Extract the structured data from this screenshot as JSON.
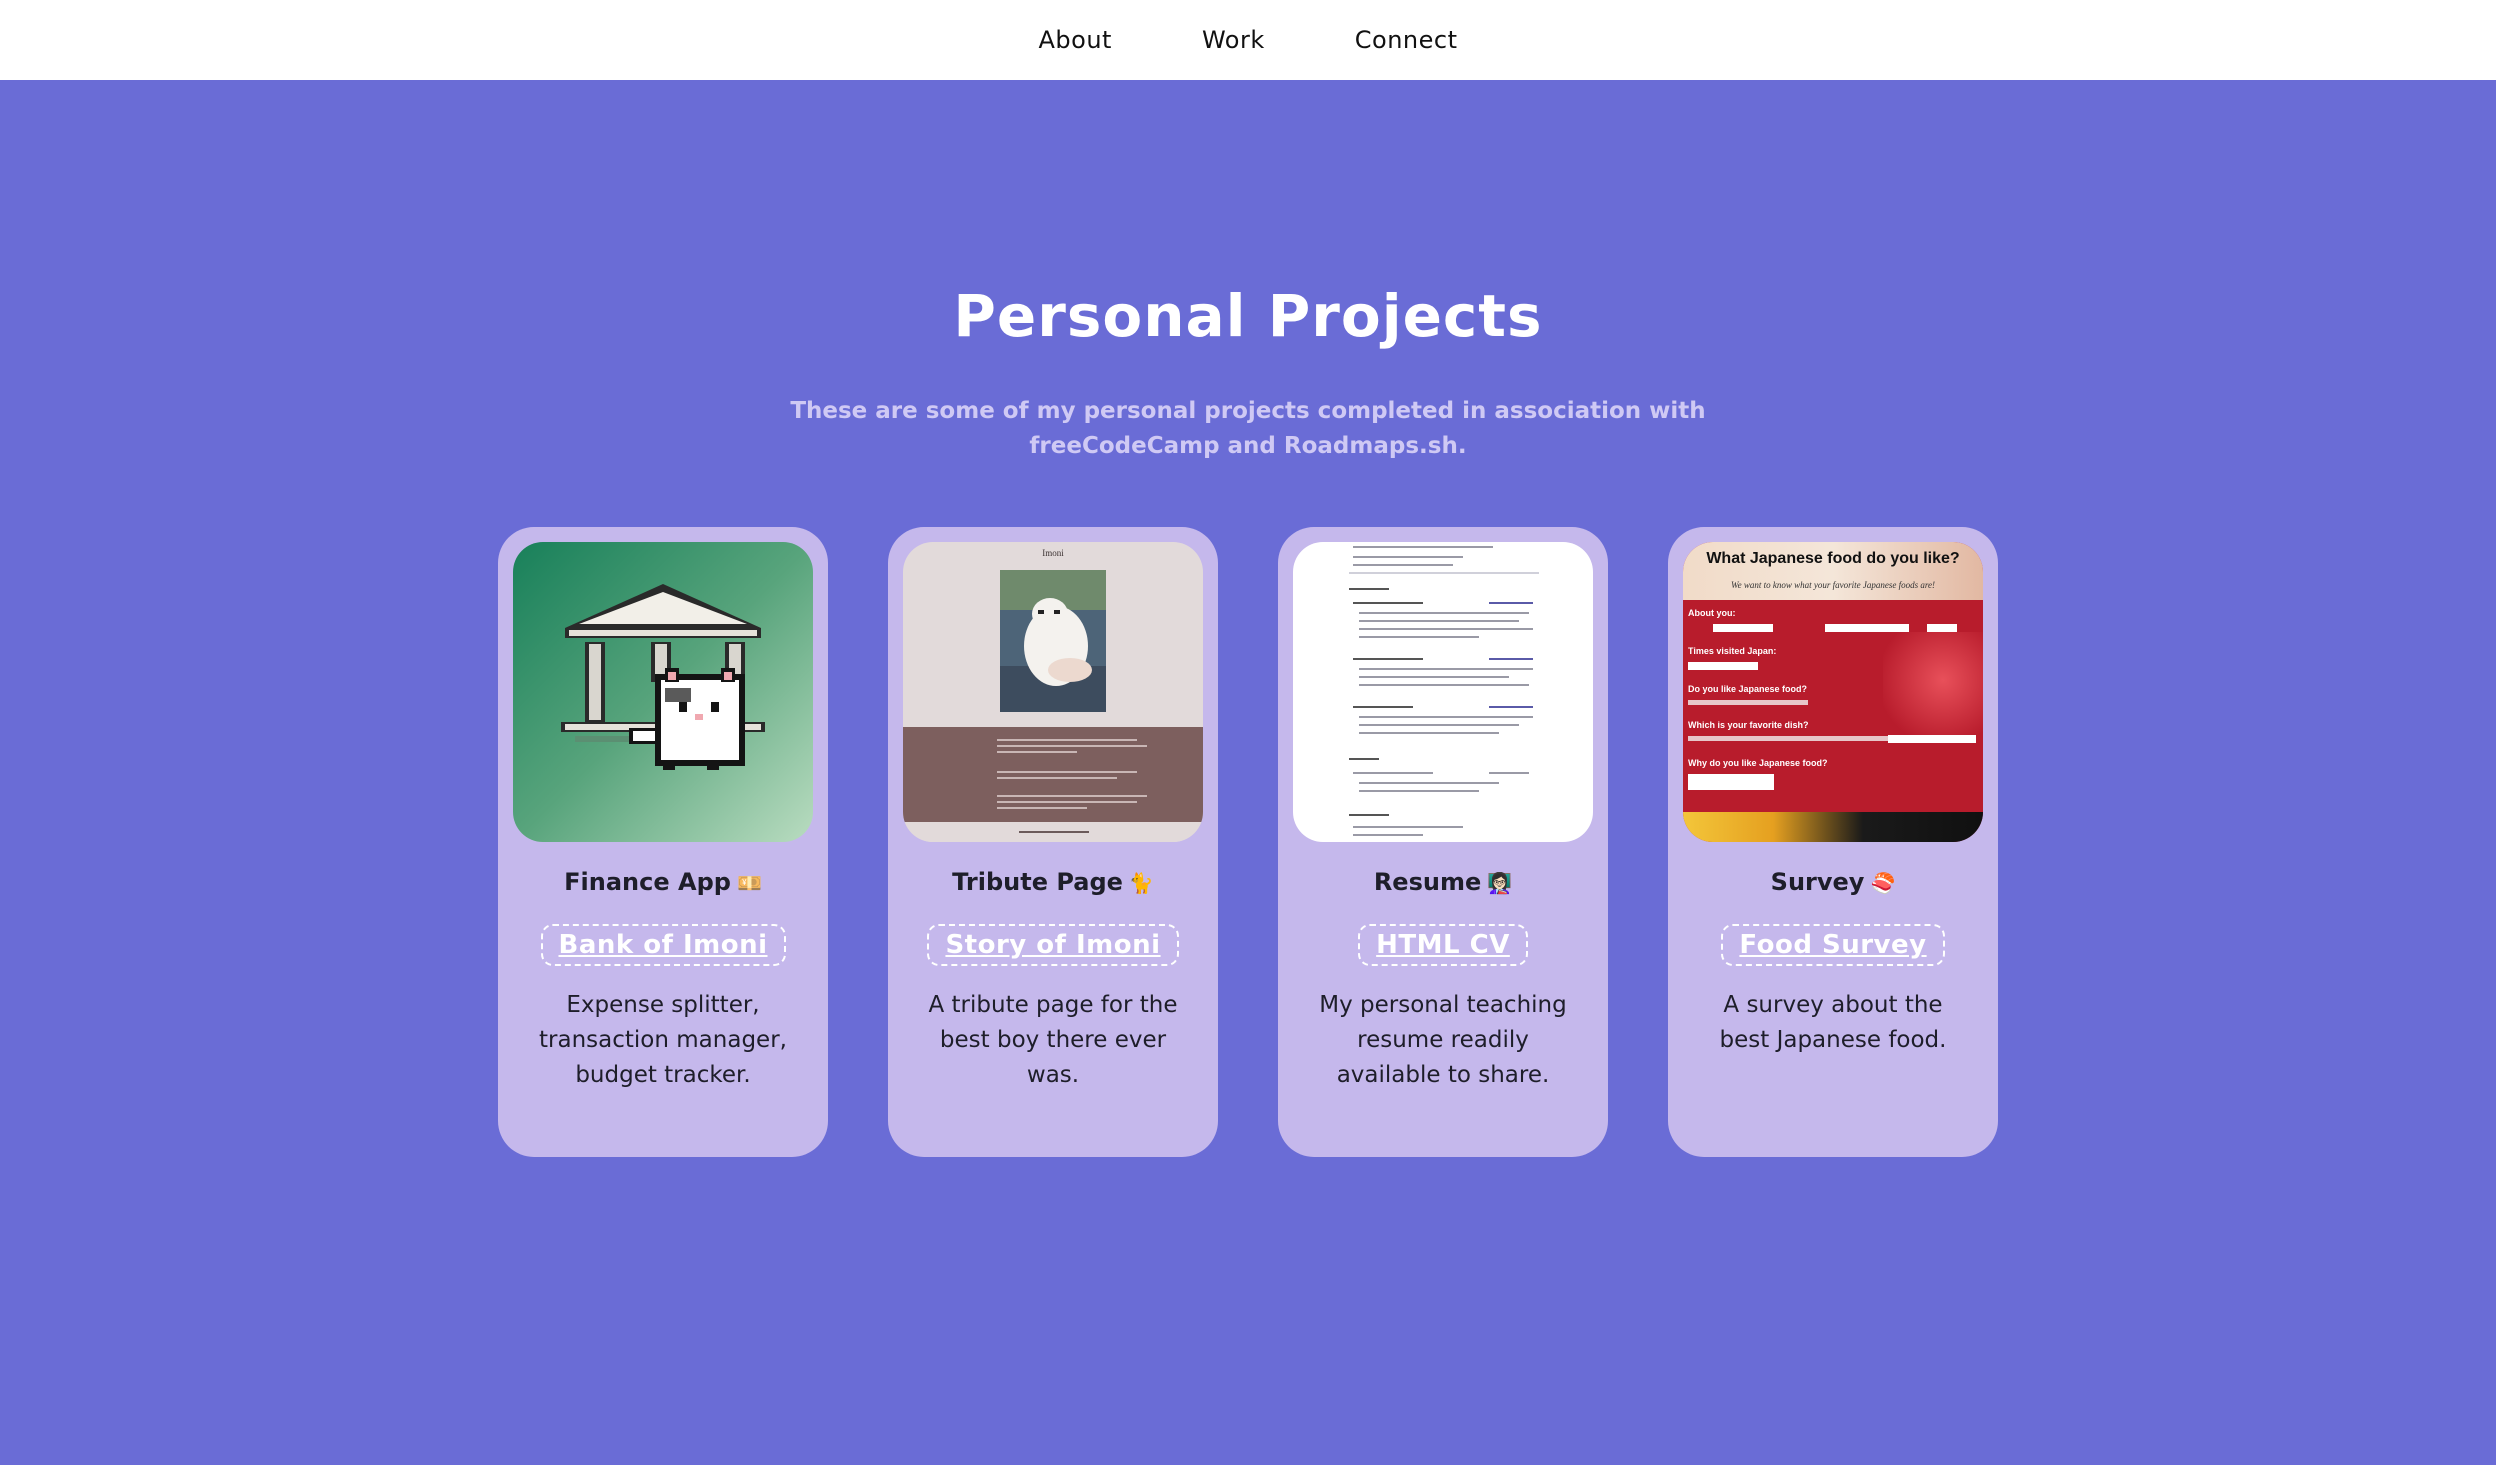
{
  "nav": {
    "items": [
      {
        "label": "About"
      },
      {
        "label": "Work"
      },
      {
        "label": "Connect"
      }
    ]
  },
  "section": {
    "title": "Personal Projects",
    "subtitle": "These are some of my personal projects completed in association with freeCodeCamp and Roadmaps.sh."
  },
  "projects": [
    {
      "name": "Finance App",
      "emoji": "💴",
      "link_label": "Bank of Imoni",
      "description": "Expense splitter, transaction manager, budget tracker.",
      "thumbnail": "pixel-bank-cat-icon"
    },
    {
      "name": "Tribute Page",
      "emoji": "🐈",
      "link_label": "Story of Imoni",
      "description": "A tribute page for the best boy there ever was.",
      "thumbnail": "tribute-page-screenshot",
      "thumb_heading": "Imoni"
    },
    {
      "name": "Resume",
      "emoji": "👩🏻‍🏫",
      "link_label": "HTML CV",
      "description": "My personal teaching resume readily available to share.",
      "thumbnail": "resume-page-screenshot"
    },
    {
      "name": "Survey",
      "emoji": "🍣",
      "link_label": "Food Survey",
      "description": "A survey about the best Japanese food.",
      "thumbnail": "survey-page-screenshot",
      "thumb_heading": "What Japanese food do you like?",
      "thumb_subheading": "We want to know what your favorite Japanese foods are!",
      "thumb_labels": {
        "about": "About you:",
        "times": "Times visited Japan:",
        "like": "Do you like Japanese food?",
        "dish": "Which is your favorite dish?",
        "why": "Why do you like Japanese food?"
      }
    }
  ],
  "colors": {
    "background": "#6a6cd6",
    "card": "#c5b8ec",
    "nav_bg": "#ffffff",
    "subtitle": "#cfc9f4"
  }
}
